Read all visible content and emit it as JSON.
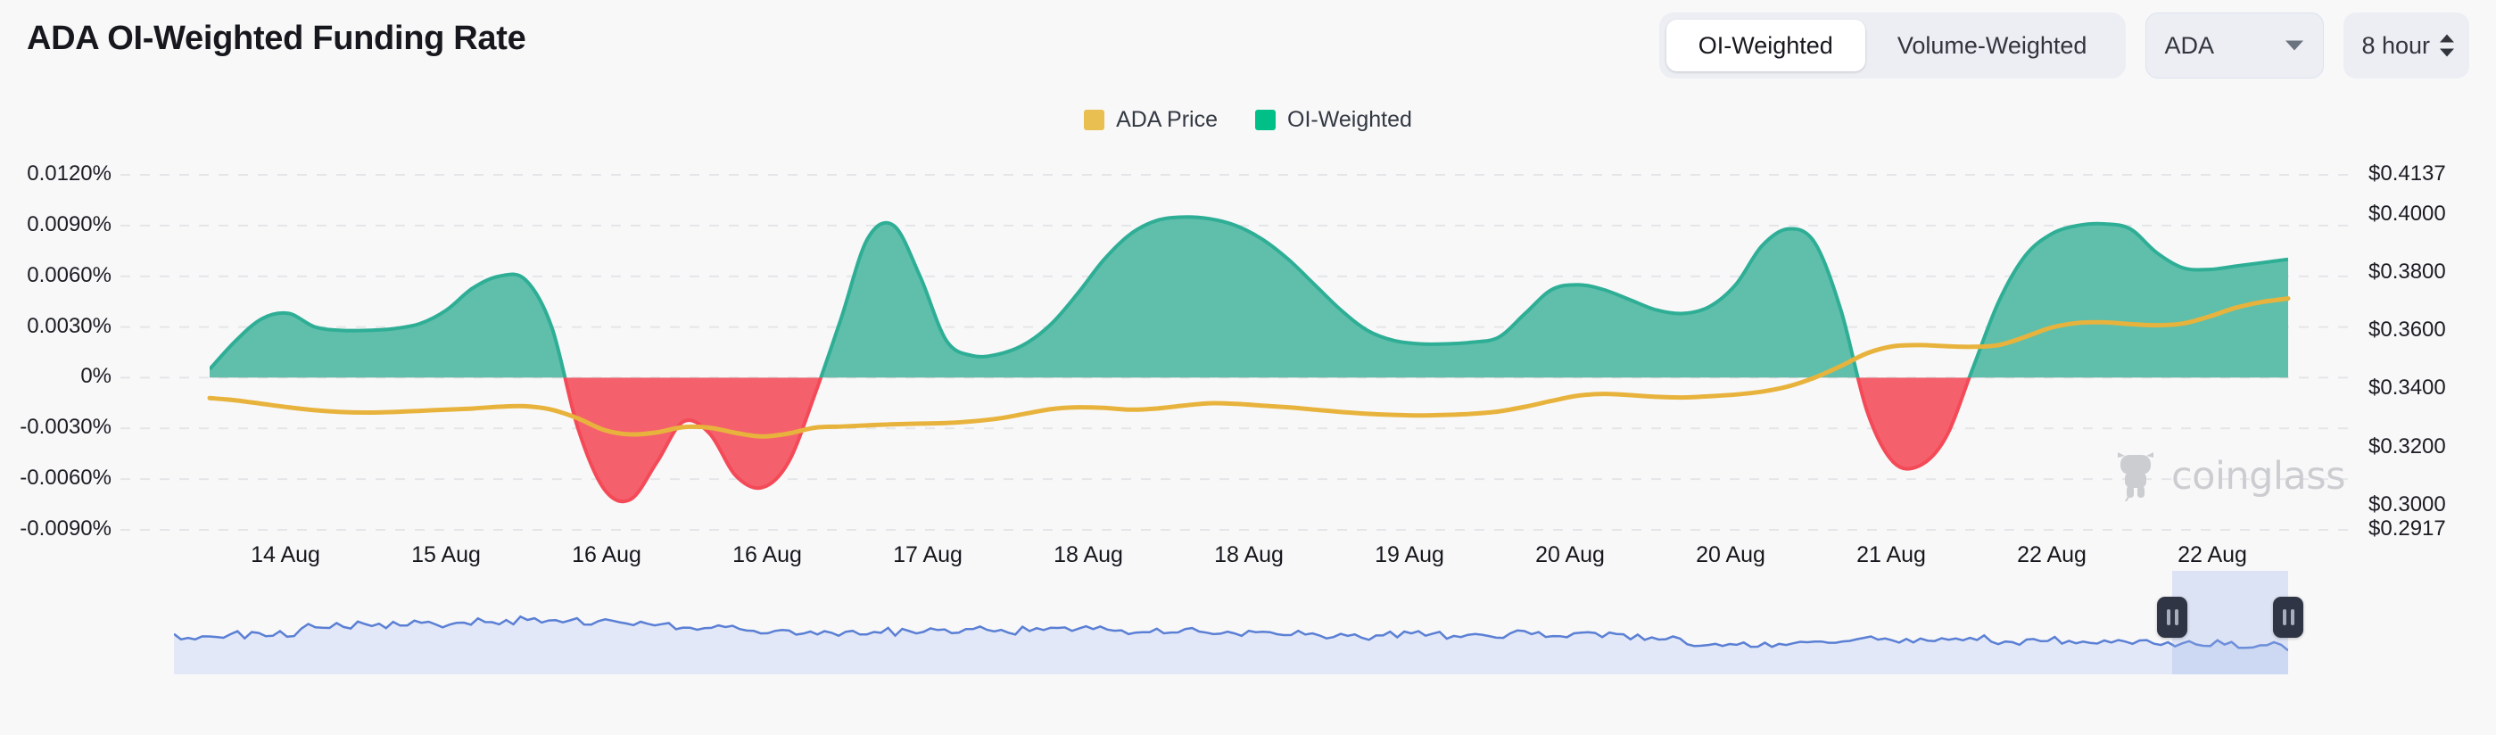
{
  "header": {
    "title": "ADA OI-Weighted Funding Rate",
    "toggle": {
      "options": [
        {
          "label": "OI-Weighted",
          "selected": true
        },
        {
          "label": "Volume-Weighted",
          "selected": false
        }
      ]
    },
    "asset_select": {
      "value": "ADA",
      "icon": "chevron-down-icon"
    },
    "interval_stepper": {
      "value": "8 hour",
      "icon": "up-down-stepper-icon"
    }
  },
  "legend": {
    "items": [
      {
        "label": "ADA Price",
        "color": "#e8bf50"
      },
      {
        "label": "OI-Weighted",
        "color": "#00c087"
      }
    ]
  },
  "watermark": {
    "text": "coinglass",
    "icon": "coinglass-bull-icon",
    "color": "#cccdd1"
  },
  "navigator": {
    "selection": {
      "start_label": "",
      "end_label": ""
    },
    "left_handle": "brush-handle-left",
    "right_handle": "brush-handle-right"
  },
  "chart_data": {
    "type": "area",
    "title": "ADA OI-Weighted Funding Rate",
    "xlabel": "",
    "ylabel": "",
    "grid": true,
    "legend_position": "top-center",
    "x_tick_labels": [
      "14 Aug",
      "15 Aug",
      "16 Aug",
      "16 Aug",
      "17 Aug",
      "18 Aug",
      "18 Aug",
      "19 Aug",
      "20 Aug",
      "20 Aug",
      "21 Aug",
      "22 Aug",
      "22 Aug"
    ],
    "y_left": {
      "label": "Funding Rate",
      "ticks": [
        "0.0120%",
        "0.0090%",
        "0.0060%",
        "0.0030%",
        "0%",
        "-0.0030%",
        "-0.0060%",
        "-0.0090%"
      ],
      "values": [
        0.012,
        0.009,
        0.006,
        0.003,
        0,
        -0.003,
        -0.006,
        -0.009
      ],
      "min": -0.009,
      "max": 0.012,
      "unit": "%"
    },
    "y_right": {
      "label": "ADA Price",
      "ticks": [
        "$0.4137",
        "$0.4000",
        "$0.3800",
        "$0.3600",
        "$0.3400",
        "$0.3200",
        "$0.3000",
        "$0.2917"
      ],
      "values": [
        0.4137,
        0.4,
        0.38,
        0.36,
        0.34,
        0.32,
        0.3,
        0.2917
      ],
      "min": 0.2917,
      "max": 0.4137,
      "unit": "$"
    },
    "series": [
      {
        "name": "OI-Weighted",
        "type": "area",
        "axis": "left",
        "positive_color": "#5fbfab",
        "negative_color": "#f4616c",
        "values": [
          0.0005,
          0.0022,
          0.0035,
          0.0038,
          0.003,
          0.0028,
          0.0028,
          0.0029,
          0.0032,
          0.004,
          0.0053,
          0.006,
          0.0058,
          0.003,
          -0.003,
          -0.0066,
          -0.0072,
          -0.005,
          -0.0026,
          -0.0033,
          -0.0058,
          -0.0065,
          -0.005,
          -0.001,
          0.0035,
          0.0082,
          0.009,
          0.006,
          0.0022,
          0.0013,
          0.0014,
          0.002,
          0.0032,
          0.005,
          0.007,
          0.0085,
          0.0093,
          0.0095,
          0.0094,
          0.009,
          0.0082,
          0.007,
          0.0055,
          0.004,
          0.0028,
          0.0022,
          0.002,
          0.002,
          0.0021,
          0.0024,
          0.0038,
          0.0052,
          0.0055,
          0.0052,
          0.0046,
          0.004,
          0.0038,
          0.0042,
          0.0055,
          0.0078,
          0.0088,
          0.008,
          0.004,
          -0.002,
          -0.005,
          -0.0052,
          -0.0035,
          0.0005,
          0.0045,
          0.0072,
          0.0085,
          0.009,
          0.0091,
          0.0088,
          0.0074,
          0.0065,
          0.0064,
          0.0066,
          0.0068,
          0.007
        ]
      },
      {
        "name": "ADA Price",
        "type": "line",
        "axis": "right",
        "color": "#e8b33c",
        "values": [
          0.337,
          0.3362,
          0.335,
          0.3338,
          0.3328,
          0.3322,
          0.332,
          0.3322,
          0.3326,
          0.333,
          0.3334,
          0.334,
          0.3342,
          0.333,
          0.33,
          0.326,
          0.3245,
          0.3252,
          0.327,
          0.3268,
          0.325,
          0.3238,
          0.3248,
          0.3268,
          0.3272,
          0.3276,
          0.328,
          0.3282,
          0.3284,
          0.329,
          0.33,
          0.3316,
          0.3332,
          0.3338,
          0.3336,
          0.333,
          0.3334,
          0.3344,
          0.3352,
          0.335,
          0.3344,
          0.3338,
          0.333,
          0.3322,
          0.3316,
          0.3312,
          0.331,
          0.3312,
          0.3316,
          0.3324,
          0.334,
          0.336,
          0.3378,
          0.3384,
          0.338,
          0.3374,
          0.3372,
          0.3376,
          0.3382,
          0.3392,
          0.341,
          0.344,
          0.348,
          0.3524,
          0.3548,
          0.3552,
          0.3548,
          0.3546,
          0.3552,
          0.358,
          0.3612,
          0.3628,
          0.363,
          0.3624,
          0.362,
          0.3626,
          0.365,
          0.368,
          0.37,
          0.3712
        ]
      }
    ],
    "navigator_series": {
      "name": "ADA Price (overview)",
      "type": "area",
      "color": "#5a7fd4",
      "fill": "#e2e8f7"
    }
  }
}
